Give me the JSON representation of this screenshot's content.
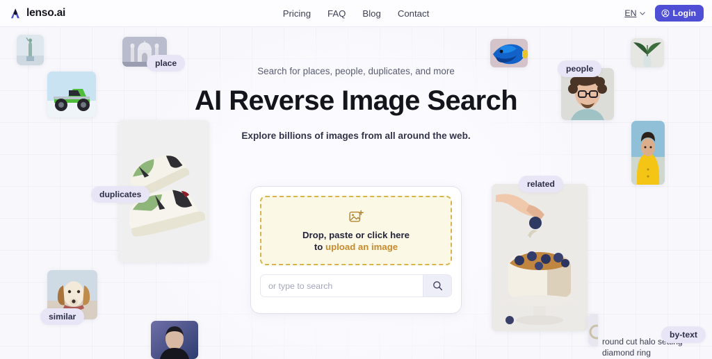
{
  "header": {
    "logo_text": "lenso.ai",
    "logo_icon": "lenso-logo-icon",
    "nav": [
      {
        "label": "Pricing"
      },
      {
        "label": "FAQ"
      },
      {
        "label": "Blog"
      },
      {
        "label": "Contact"
      }
    ],
    "language": {
      "code": "EN",
      "chevron_icon": "chevron-down-icon"
    },
    "login": {
      "label": "Login",
      "icon": "user-circle-icon",
      "color": "#4f4fd6"
    }
  },
  "hero": {
    "eyebrow": "Search for places, people, duplicates, and more",
    "title": "AI Reverse Image Search",
    "subtitle": "Explore billions of images from all around the web."
  },
  "upload_card": {
    "dropzone": {
      "icon": "image-plus-icon",
      "line1": "Drop, paste or click here",
      "line2_prefix": "to ",
      "line2_accent": "upload an image",
      "border_color": "#d9b44a",
      "background_color": "#fbf8e6"
    },
    "search": {
      "placeholder": "or type to search",
      "value": "",
      "button_icon": "search-icon"
    }
  },
  "pills": [
    {
      "label": "place"
    },
    {
      "label": "duplicates"
    },
    {
      "label": "similar"
    },
    {
      "label": "people"
    },
    {
      "label": "related"
    },
    {
      "label": "by-text"
    }
  ],
  "by_text_caption": "round cut halo setting diamond ring",
  "thumbnails": [
    {
      "name": "statue-of-liberty"
    },
    {
      "name": "green-monster-truck"
    },
    {
      "name": "taj-mahal"
    },
    {
      "name": "green-white-sneakers"
    },
    {
      "name": "beagle-dog"
    },
    {
      "name": "portrait-woman-blue"
    },
    {
      "name": "blue-tang-fish"
    },
    {
      "name": "man-with-glasses"
    },
    {
      "name": "plant-in-vase"
    },
    {
      "name": "woman-yellow-hood"
    },
    {
      "name": "blueberry-cake"
    },
    {
      "name": "diamond-ring"
    }
  ],
  "colors": {
    "page_bg": "#f8f8fc",
    "accent": "#4f4fd6",
    "pill_bg": "#e7e5f6",
    "upload_accent": "#c98a2e"
  }
}
